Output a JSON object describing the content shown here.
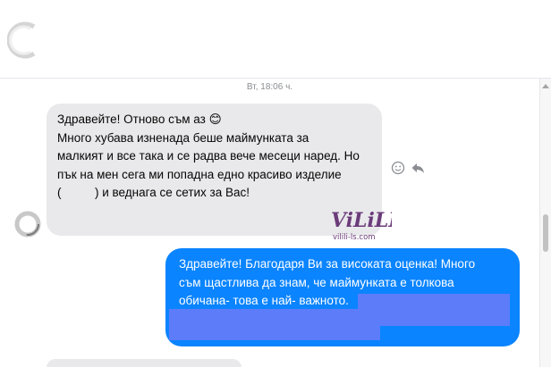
{
  "header": {
    "avatar_icon": "contact-avatar-icon"
  },
  "chat": {
    "timestamp": "Вт, 18:06 ч.",
    "incoming": {
      "lines": [
        "Здравейте! Отново съм аз 😊",
        "Много хубава изненада беше маймунката за",
        "малкият и все така и се радва вече месеци наред. Но",
        "пък на мен сега ми попадна едно красиво изделие",
        "(          ) и веднага се сетих за Вас!"
      ],
      "actions": [
        "react-icon",
        "reply-icon"
      ]
    },
    "outgoing": {
      "lines": [
        "Здравейте! Благодаря Ви за високата оценка! Много",
        "съм щастлива да знам, че маймунката е толкова",
        "обичана- това е най- важното."
      ]
    },
    "watermark": {
      "name": "ViLiLL",
      "domain": "vilili-ls.com"
    }
  },
  "colors": {
    "incoming_bubble": "#e9e9eb",
    "outgoing_bubble": "#0a84ff",
    "redaction": "#5c7cfa",
    "timestamp": "#8a8d91"
  }
}
